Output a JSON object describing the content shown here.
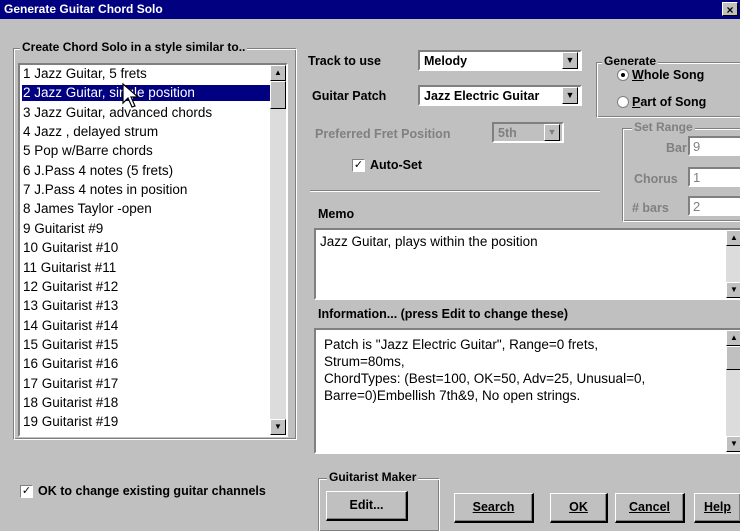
{
  "window": {
    "title": "Generate Guitar Chord Solo",
    "close_label": "×"
  },
  "style_group": {
    "legend": "Create Chord Solo in a style similar to..",
    "items": [
      "1 Jazz Guitar, 5 frets",
      "2 Jazz Guitar, single position",
      "3 Jazz Guitar, advanced chords",
      "4 Jazz , delayed strum",
      "5 Pop w/Barre chords",
      "6 J.Pass 4 notes (5 frets)",
      "7 J.Pass 4 notes in position",
      "8 James Taylor -open",
      "9 Guitarist #9",
      "10 Guitarist #10",
      "11 Guitarist #11",
      "12 Guitarist #12",
      "13 Guitarist #13",
      "14 Guitarist #14",
      "15 Guitarist #15",
      "16 Guitarist #16",
      "17 Guitarist #17",
      "18 Guitarist #18",
      "19 Guitarist #19"
    ],
    "selected_index": 1
  },
  "track": {
    "label": "Track to use",
    "value": "Melody"
  },
  "patch": {
    "label": "Guitar Patch",
    "value": "Jazz Electric Guitar"
  },
  "fret": {
    "label": "Preferred Fret Position",
    "value": "5th"
  },
  "auto_set": {
    "label": "Auto-Set",
    "checked": true
  },
  "generate": {
    "legend": "Generate",
    "whole_song": "Whole Song",
    "part_of_song": "Part of Song",
    "selected": "whole_song"
  },
  "set_range": {
    "legend": "Set Range",
    "bar_label": "Bar",
    "bar_value": "9",
    "chorus_label": "Chorus",
    "chorus_value": "1",
    "bars_label": "# bars",
    "bars_value": "2"
  },
  "memo": {
    "label": "Memo",
    "text": "Jazz Guitar, plays within the position"
  },
  "information": {
    "label": "Information... (press Edit to change these)",
    "lines": [
      "Patch is \"Jazz Electric Guitar\", Range=0 frets,",
      "Strum=80ms,",
      "ChordTypes: (Best=100, OK=50, Adv=25, Unusual=0,",
      "Barre=0)Embellish 7th&9, No open strings."
    ]
  },
  "ok_change": {
    "label": "OK to change existing guitar channels",
    "checked": true
  },
  "guitarist_maker": {
    "legend": "Guitarist Maker",
    "edit_label": "Edit..."
  },
  "buttons": {
    "search": "Search",
    "ok": "OK",
    "cancel": "Cancel",
    "help": "Help"
  }
}
